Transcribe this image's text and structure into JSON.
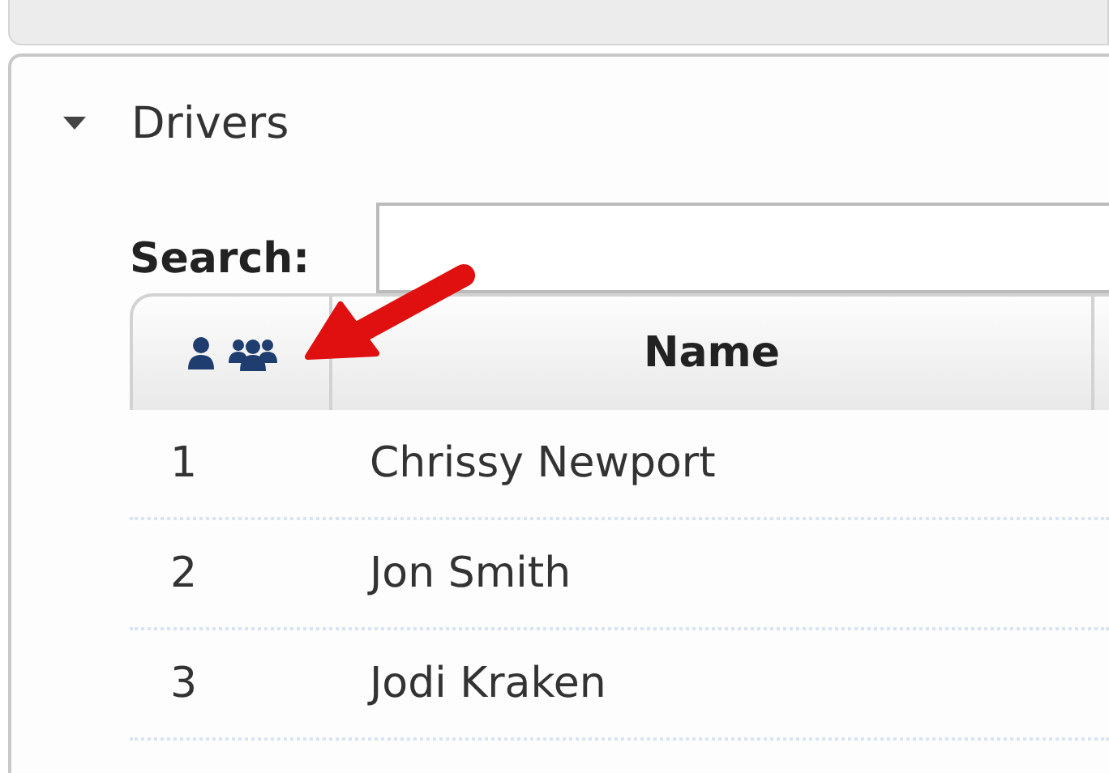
{
  "section": {
    "title": "Drivers",
    "expanded": true
  },
  "search": {
    "label": "Search:"
  },
  "table": {
    "columns": [
      {
        "kind": "icons"
      },
      {
        "kind": "text",
        "label": "Name"
      }
    ],
    "rows": [
      {
        "number": "1",
        "name": "Chrissy Newport"
      },
      {
        "number": "2",
        "name": "Jon Smith"
      },
      {
        "number": "3",
        "name": "Jodi Kraken"
      }
    ]
  }
}
